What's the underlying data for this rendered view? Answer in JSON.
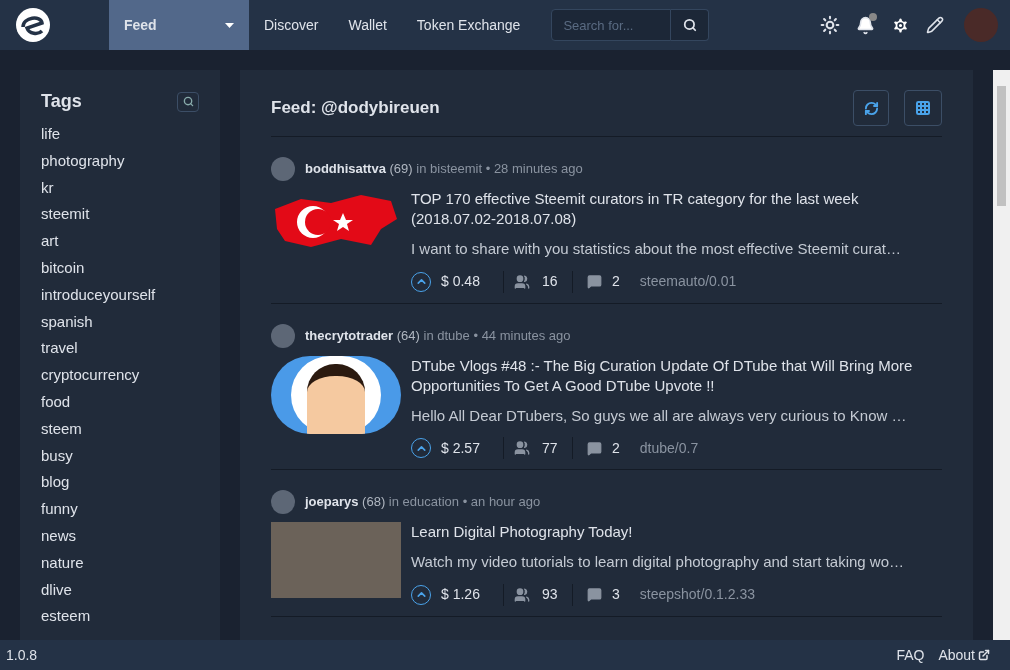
{
  "nav": {
    "items": [
      {
        "label": "Feed",
        "selected": true,
        "dropdown": true
      },
      {
        "label": "Discover",
        "selected": false,
        "dropdown": false
      },
      {
        "label": "Wallet",
        "selected": false,
        "dropdown": false
      },
      {
        "label": "Token Exchange",
        "selected": false,
        "dropdown": false
      }
    ],
    "search": {
      "placeholder": "Search for..."
    },
    "notifications_unread": true
  },
  "sidebar": {
    "title": "Tags",
    "tags": [
      "life",
      "photography",
      "kr",
      "steemit",
      "art",
      "bitcoin",
      "introduceyourself",
      "spanish",
      "travel",
      "cryptocurrency",
      "food",
      "steem",
      "busy",
      "blog",
      "funny",
      "news",
      "nature",
      "dlive",
      "esteem"
    ]
  },
  "feed": {
    "title": "Feed: @dodybireuen",
    "posts": [
      {
        "author": "boddhisattva",
        "reputation": "(69)",
        "in": "in",
        "category": "bisteemit",
        "separator": "•",
        "time": "28 minutes ago",
        "title": "TOP 170 effective Steemit curators in TR category for the last week (2018.07.02-2018.07.08)",
        "summary": "I want to share with you statistics about the most effective Steemit curat…",
        "payout": "$ 0.48",
        "voters": "16",
        "comments": "2",
        "app": "steemauto/0.01",
        "kind": "flag"
      },
      {
        "author": "thecrytotrader",
        "reputation": "(64)",
        "in": "in",
        "category": "dtube",
        "separator": "•",
        "time": "44 minutes ago",
        "title": "DTube Vlogs #48 :- The Big Curation Update Of DTube that Will Bring More Opportunities To Get A Good DTube Upvote !!",
        "summary": "Hello All Dear DTubers, So guys we all are always very curious to Know …",
        "payout": "$ 2.57",
        "voters": "77",
        "comments": "2",
        "app": "dtube/0.7",
        "kind": "cartoon"
      },
      {
        "author": "joeparys",
        "reputation": "(68)",
        "in": "in",
        "category": "education",
        "separator": "•",
        "time": "an hour ago",
        "title": "Learn Digital Photography Today!",
        "summary": "Watch my video tutorials to learn digital photography and start taking wo…",
        "payout": "$ 1.26",
        "voters": "93",
        "comments": "3",
        "app": "steepshot/0.1.2.33",
        "kind": "photo"
      }
    ]
  },
  "footer": {
    "version": "1.0.8",
    "links": [
      {
        "label": "FAQ",
        "external": false
      },
      {
        "label": "About",
        "external": true
      }
    ]
  }
}
